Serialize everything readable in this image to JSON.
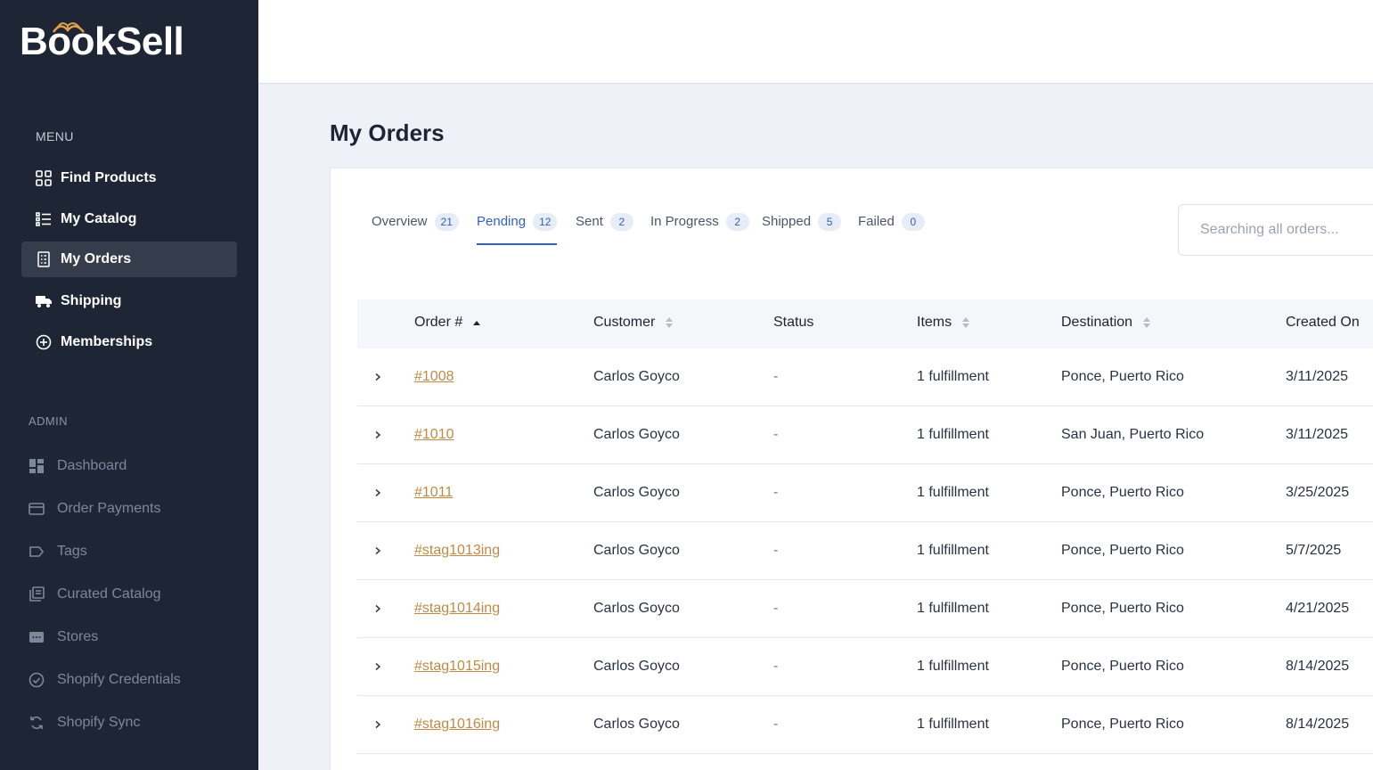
{
  "brand": {
    "name": "BookSell"
  },
  "sidebar": {
    "menu_label": "MENU",
    "menu_items": [
      {
        "label": "Find Products",
        "icon": "grid-icon"
      },
      {
        "label": "My Catalog",
        "icon": "list-icon"
      },
      {
        "label": "My Orders",
        "icon": "receipt-icon",
        "active": true
      },
      {
        "label": "Shipping",
        "icon": "truck-icon"
      },
      {
        "label": "Memberships",
        "icon": "plus-circle-icon"
      }
    ],
    "admin_label": "ADMIN",
    "admin_items": [
      {
        "label": "Dashboard",
        "icon": "dashboard-icon"
      },
      {
        "label": "Order Payments",
        "icon": "credit-card-icon"
      },
      {
        "label": "Tags",
        "icon": "tag-icon"
      },
      {
        "label": "Curated Catalog",
        "icon": "library-icon"
      },
      {
        "label": "Stores",
        "icon": "store-icon"
      },
      {
        "label": "Shopify Credentials",
        "icon": "check-circle-icon"
      },
      {
        "label": "Shopify Sync",
        "icon": "sync-icon"
      }
    ]
  },
  "main": {
    "title": "My Orders",
    "tabs": [
      {
        "label": "Overview",
        "count": "21"
      },
      {
        "label": "Pending",
        "count": "12",
        "active": true
      },
      {
        "label": "Sent",
        "count": "2"
      },
      {
        "label": "In Progress",
        "count": "2"
      },
      {
        "label": "Shipped",
        "count": "5"
      },
      {
        "label": "Failed",
        "count": "0"
      }
    ],
    "search": {
      "placeholder": "Searching all orders..."
    },
    "table": {
      "columns": [
        "Order #",
        "Customer",
        "Status",
        "Items",
        "Destination",
        "Created On"
      ],
      "rows": [
        {
          "order": "#1008",
          "customer": "Carlos Goyco",
          "status": "-",
          "items": "1 fulfillment",
          "destination": "Ponce, Puerto Rico",
          "created": "3/11/2025"
        },
        {
          "order": "#1010",
          "customer": "Carlos Goyco",
          "status": "-",
          "items": "1 fulfillment",
          "destination": "San Juan, Puerto Rico",
          "created": "3/11/2025"
        },
        {
          "order": "#1011",
          "customer": "Carlos Goyco",
          "status": "-",
          "items": "1 fulfillment",
          "destination": "Ponce, Puerto Rico",
          "created": "3/25/2025"
        },
        {
          "order": "#stag1013ing",
          "customer": "Carlos Goyco",
          "status": "-",
          "items": "1 fulfillment",
          "destination": "Ponce, Puerto Rico",
          "created": "5/7/2025"
        },
        {
          "order": "#stag1014ing",
          "customer": "Carlos Goyco",
          "status": "-",
          "items": "1 fulfillment",
          "destination": "Ponce, Puerto Rico",
          "created": "4/21/2025"
        },
        {
          "order": "#stag1015ing",
          "customer": "Carlos Goyco",
          "status": "-",
          "items": "1 fulfillment",
          "destination": "Ponce, Puerto Rico",
          "created": "8/14/2025"
        },
        {
          "order": "#stag1016ing",
          "customer": "Carlos Goyco",
          "status": "-",
          "items": "1 fulfillment",
          "destination": "Ponce, Puerto Rico",
          "created": "8/14/2025"
        }
      ]
    }
  },
  "colors": {
    "sidebar": "#1e2636",
    "accent": "#2f62c7",
    "link": "#c08a45",
    "logo_accent": "#e0a04a"
  }
}
